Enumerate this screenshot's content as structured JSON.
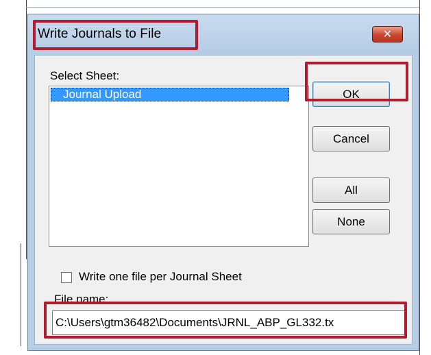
{
  "dialog": {
    "title": "Write Journals to File",
    "close_glyph": "✕"
  },
  "select_sheet": {
    "label": "Select Sheet:",
    "items": [
      "Journal Upload"
    ]
  },
  "buttons": {
    "ok": "OK",
    "cancel": "Cancel",
    "all": "All",
    "none": "None"
  },
  "options": {
    "write_one_file_label": "Write one file per Journal Sheet",
    "write_one_file_checked": false
  },
  "file": {
    "label": "File name:",
    "value": "C:\\Users\\gtm36482\\Documents\\JRNL_ABP_GL332.tx"
  },
  "highlight_color": "#b01c2e"
}
